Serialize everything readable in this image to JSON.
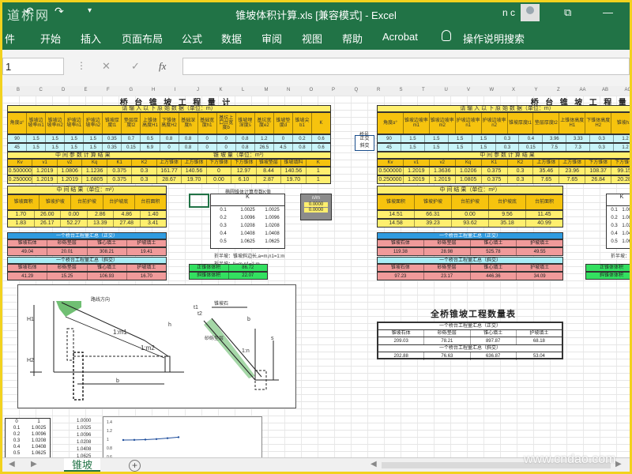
{
  "titlebar": {
    "logo_text": "道桥网",
    "window_title": "锥坡体积计算.xls  [兼容模式]  -  Excel",
    "user_initials": "n c",
    "restore_glyph": "⧉",
    "minimize_glyph": "—"
  },
  "ribbon": {
    "tabs": [
      "件",
      "开始",
      "插入",
      "页面布局",
      "公式",
      "数据",
      "审阅",
      "视图",
      "帮助",
      "Acrobat"
    ],
    "tell_me": "操作说明搜索"
  },
  "formula_bar": {
    "name_box": "1",
    "cancel_glyph": "✕",
    "confirm_glyph": "✓",
    "fx_glyph": "fx",
    "content": ""
  },
  "column_letters": [
    "B",
    "C",
    "D",
    "E",
    "F",
    "G",
    "H",
    "I",
    "J",
    "K",
    "L",
    "M",
    "N",
    "O",
    "P",
    "Q",
    "R",
    "S",
    "T",
    "U",
    "V",
    "W",
    "X",
    "Y",
    "Z",
    "AA",
    "AB",
    "AC"
  ],
  "left_block": {
    "title": "桥 台 锥 坡 工 程 量 计 算",
    "input_header": "请 输 入 以 下 原 始 数 据（单位：m）",
    "input_cols": [
      "角度α°",
      "锥坡边坡率m1",
      "锥坡边坡率m2",
      "护坡边坡率n1",
      "护坡边坡率n2",
      "锥坡厚度t1",
      "垫层厚度t2",
      "上锥体高度H1",
      "下锥体高度H2",
      "基础深度h",
      "基础宽度h1",
      "基坑上口台宽度b",
      "锥坡埋深度s",
      "基坑宽度e2",
      "锥坡垫度d",
      "锥坡尖b1",
      "K"
    ],
    "input_rows": [
      [
        "90",
        "1.5",
        "1.5",
        "1.5",
        "1.5",
        "0.35",
        "0.7",
        "0.5",
        "0.8",
        "0.8",
        "0",
        "0",
        "0.8",
        "1.2",
        "0",
        "0.2",
        "0.6"
      ],
      [
        "45",
        "1.5",
        "1.5",
        "1.5",
        "1.5",
        "0.35",
        "0.15",
        "6.9",
        "0",
        "0.8",
        "0",
        "0",
        "0.8",
        "26.5",
        "4.5",
        "0.8",
        "0.6"
      ]
    ],
    "mid_header": "中 间 参 数 计 算 结 果",
    "mid_header2": "锥 坡 量（单位：m³）",
    "mid_cols": [
      "Kv",
      "v1",
      "v2",
      "Kq",
      "K1",
      "K2",
      "上方锥体",
      "上方锥体",
      "下方锥体",
      "下方锥体",
      "锥坡垫层",
      "锥坡填料",
      "K"
    ],
    "mid_rows": [
      [
        "0.500000",
        "1.2019",
        "1.0806",
        "1.1236",
        "0.375",
        "0.3",
        "161.77",
        "140.56",
        "0",
        "12.97",
        "8.44",
        "140.56",
        "1"
      ],
      [
        "0.250000",
        "1.2019",
        "1.2019",
        "1.0805",
        "0.375",
        "0.3",
        "28.67",
        "19.70",
        "0.00",
        "6.10",
        "2.87",
        "19.70",
        "1"
      ]
    ],
    "result_header": "中 间 结 果（单位：m²）",
    "result_cols": [
      "锥坡面积",
      "锥坡护坡",
      "台前护坡",
      "台护坡底",
      "台前面积"
    ],
    "result_rows": [
      [
        "1.70",
        "26.00",
        "0.00",
        "2.86",
        "4.86",
        "1.40"
      ],
      [
        "1.83",
        "26.17",
        "52.27",
        "13.39",
        "27.48",
        "3.41"
      ]
    ],
    "sum1_header": "一个桥台工程量汇总（正交）",
    "sum_cols": [
      "锥坡石体",
      "砂砾垫层",
      "锥心填土",
      "护坡填土"
    ],
    "sum1_vals": [
      "49.04",
      "20.01",
      "308.21",
      "19.41"
    ],
    "sum2_header": "一个桥台工程量汇总（斜交）",
    "sum2_vals": [
      "41.29",
      "15.25",
      "106.93",
      "16.70"
    ]
  },
  "k_table": {
    "title": "椭圆锥体计算参数K值",
    "col1": [
      "0.1",
      "0.2",
      "0.3",
      "0.4",
      "0.5"
    ],
    "col2": [
      "1.0025",
      "1.0096",
      "1.0208",
      "1.0408",
      "1.0625"
    ],
    "col3": [
      "1.0025",
      "1.0096",
      "1.0208",
      "1.0408",
      "1.0625"
    ],
    "header_K": "K",
    "note1": "折半坡：锥坡斜边长,a=m,n1=1:m",
    "note2": "折半坡：h=m,n1=1:m",
    "n_label": "n/m",
    "n_vals": [
      "0.0000",
      "0.0000"
    ]
  },
  "green_boxes": {
    "left1_label": "正锥体体积",
    "left1_val": "86.72",
    "left2_label": "斜锥体体积",
    "left2_val": "22.07",
    "right1_label": "正锥体体积",
    "right2_label": "斜锥体体积"
  },
  "diagram": {
    "label_slope1": "1:m1",
    "label_slope2": "1:m2",
    "label_H1": "H1",
    "label_H2": "H2",
    "label_b": "b",
    "label_top": "路线方向",
    "label_protect": "锥坡石",
    "label_base": "砂砾垫层",
    "label_s": "s",
    "label_h": "h",
    "label_t1": "t1",
    "label_t2": "t2",
    "label_n": "1:n"
  },
  "right_block": {
    "title": "桥 台 锥 坡 工 程 量 计 算",
    "input_header": "请 输 入 以 下 原 始 数 据（单位：m）",
    "side_labels": [
      "正交",
      "斜交"
    ],
    "side_header": "桥号",
    "input_cols": [
      "角度α°",
      "锥坡边坡率m1",
      "锥坡边坡率m2",
      "护坡边坡率n1",
      "护坡边坡率n2",
      "锥坡厚度t1",
      "垫层厚度t2",
      "上锥体高度H1",
      "下锥体高度H2",
      "锥坡h1"
    ],
    "input_rows": [
      [
        "90",
        "1.5",
        "1.5",
        "1.5",
        "1.5",
        "0.3",
        "0.4",
        "3.96",
        "3.33",
        "0.3",
        "1.2"
      ],
      [
        "45",
        "1.5",
        "1.5",
        "1.5",
        "1.5",
        "0.3",
        "0.15",
        "7.5",
        "7.3",
        "0.3",
        "1.2"
      ]
    ],
    "mid_header": "中 间 参 数 计 算 结 果",
    "mid_rows": [
      [
        "0.500000",
        "1.2019",
        "1.3636",
        "1.0206",
        "0.375",
        "0.3",
        "35.46",
        "23.96",
        "108.37",
        "99.15"
      ],
      [
        "0.250000",
        "1.2019",
        "1.2019",
        "1.0805",
        "0.375",
        "0.3",
        "7.65",
        "7.65",
        "26.84",
        "20.28"
      ]
    ],
    "result_header": "中 间 结 果（单位：m²）",
    "result_rows": [
      [
        "14.51",
        "66.31",
        "0.00",
        "9.56",
        "11.45"
      ],
      [
        "14.58",
        "39.23",
        "93.62",
        "35.18",
        "40.99"
      ]
    ],
    "sum1_header": "一个桥台工程量汇总（正交）",
    "sum_cols": [
      "锥坡石体",
      "砂砾垫层",
      "锥心填土",
      "护坡填土"
    ],
    "sum1_vals": [
      "119.38",
      "28.98",
      "525.78",
      "49.55"
    ],
    "sum2_header": "一个桥台工程量汇总（斜交）",
    "sum2_vals": [
      "97.23",
      "23.17",
      "446.36",
      "34.09"
    ],
    "notes": [
      "折半坡：",
      "折半坡："
    ]
  },
  "summary": {
    "title": "全桥锥坡工程数量表",
    "hdr1": "一个桥台工程量汇总（正交）",
    "cols": [
      "锥坡石体",
      "砂砾垫层",
      "锥心填土",
      "护坡填土"
    ],
    "row1": [
      "209.03",
      "78.21",
      "897.87",
      "68.18"
    ],
    "hdr2": "一个桥台工程量汇总（斜交）",
    "row2": [
      "202.88",
      "76.63",
      "636.87",
      "53.04"
    ]
  },
  "bottom_area": {
    "k_list_a": [
      "0.1",
      "0.2",
      "0.3",
      "0.4",
      "0.5"
    ],
    "k_list_b": [
      "1.0025",
      "1.0096",
      "1.0208",
      "1.0408",
      "1.0625"
    ],
    "k_head": "0",
    "k_head_val": "1",
    "k_list_c": [
      "1.0000",
      "1.0025",
      "1.0096",
      "1.0208",
      "1.0408",
      "1.0625"
    ],
    "chart_yticks": [
      "1.4",
      "1.2",
      "1",
      "0.8",
      "0.6"
    ],
    "chart_legend": "系列1"
  },
  "sheet_tabs": {
    "active": "锥坡",
    "add_glyph": "+"
  },
  "watermark": "www.cndao.com"
}
